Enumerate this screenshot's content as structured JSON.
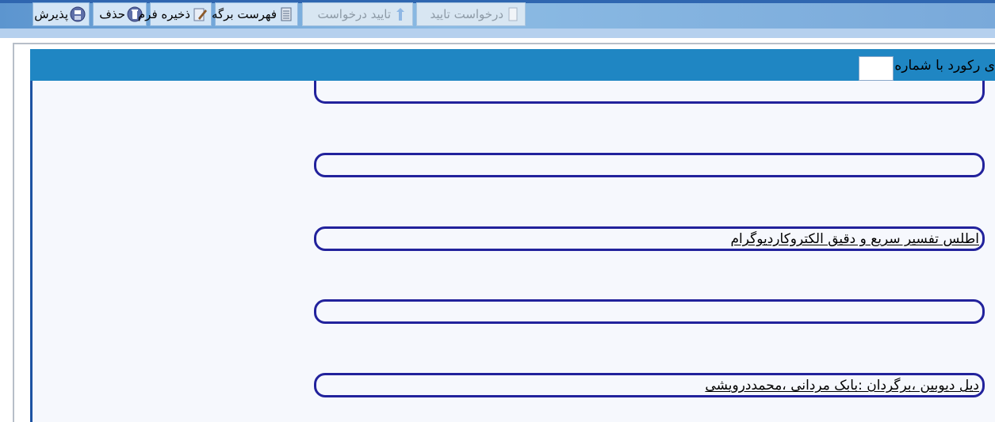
{
  "toolbar": {
    "buttons": [
      {
        "label": "پذیرش",
        "icon": "save-icon"
      },
      {
        "label": "حذف",
        "icon": "trash-icon"
      },
      {
        "label": "ذخیره فرم",
        "icon": "edit-icon"
      },
      {
        "label": "فهرست برگه",
        "icon": "list-icon"
      },
      {
        "label": "تایید درخواست",
        "icon": "approve-icon"
      },
      {
        "label": "درخواست تایید",
        "icon": "document-icon"
      }
    ],
    "record_label": "ی رکورد با شماره",
    "record_value": ""
  },
  "fields": [
    {
      "value": ""
    },
    {
      "value": ""
    },
    {
      "value": "اطلس تفسیر سریع و دقیق الکتروکاردیوگرام"
    },
    {
      "value": ""
    },
    {
      "value": "دیل دیوبین ،برگردان :بابک مردانی ،محمددرویشی"
    }
  ],
  "colors": {
    "toolbar_bg": "#1f86c3",
    "field_border": "#22229c",
    "content_bg": "#f6f8fd"
  }
}
